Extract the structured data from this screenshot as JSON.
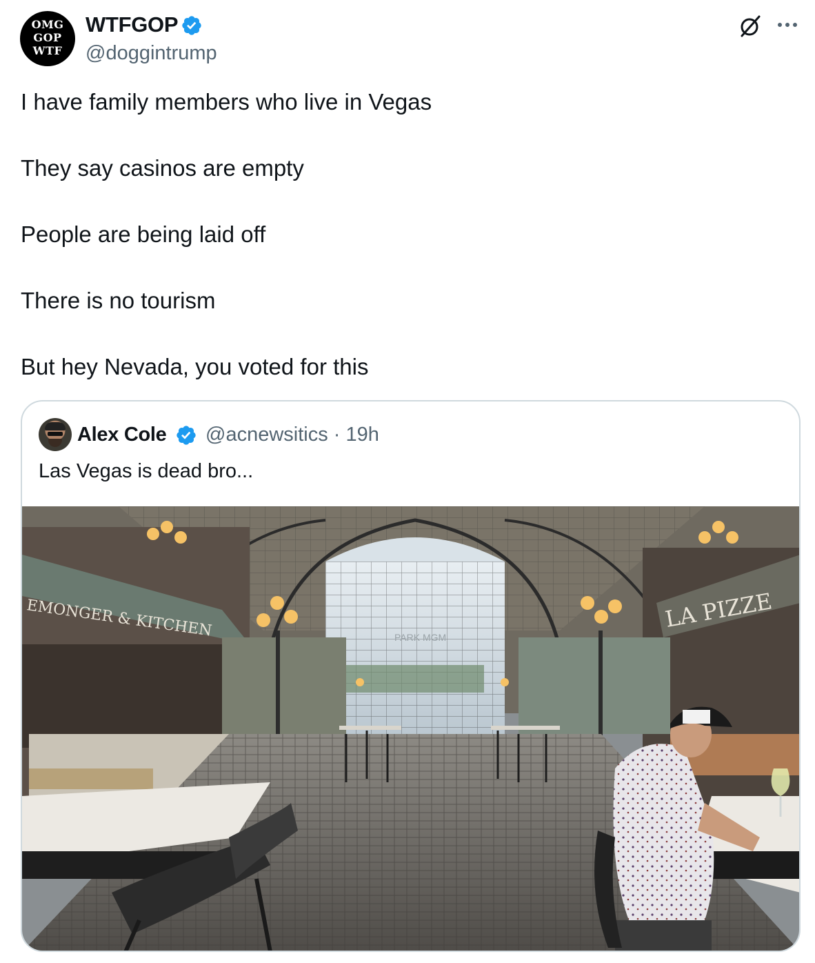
{
  "author": {
    "display_name": "WTFGOP",
    "handle": "@doggintrump",
    "avatar_text": [
      "OMG",
      "GOP",
      "WTF"
    ],
    "verified": true
  },
  "tweet": {
    "lines": [
      "I have family members who live in Vegas",
      "They say casinos are empty",
      "People are being laid off",
      "There is no tourism",
      "But hey Nevada, you voted for this"
    ]
  },
  "quote": {
    "display_name": "Alex Cole",
    "handle": "@acnewsitics",
    "meta": "@acnewsitics · 19h",
    "time": "19h",
    "text": "Las Vegas is dead bro...",
    "verified": true,
    "media": {
      "signs": [
        "EMONGER & KITCHEN",
        "LA PIZZE",
        "PARK MGM"
      ]
    }
  },
  "icons": [
    "grok-icon",
    "more-icon",
    "verified-badge-icon"
  ],
  "colors": {
    "text_primary": "#0f1419",
    "text_secondary": "#536471",
    "verified_blue": "#1d9bf0",
    "card_border": "#cfd9de"
  }
}
